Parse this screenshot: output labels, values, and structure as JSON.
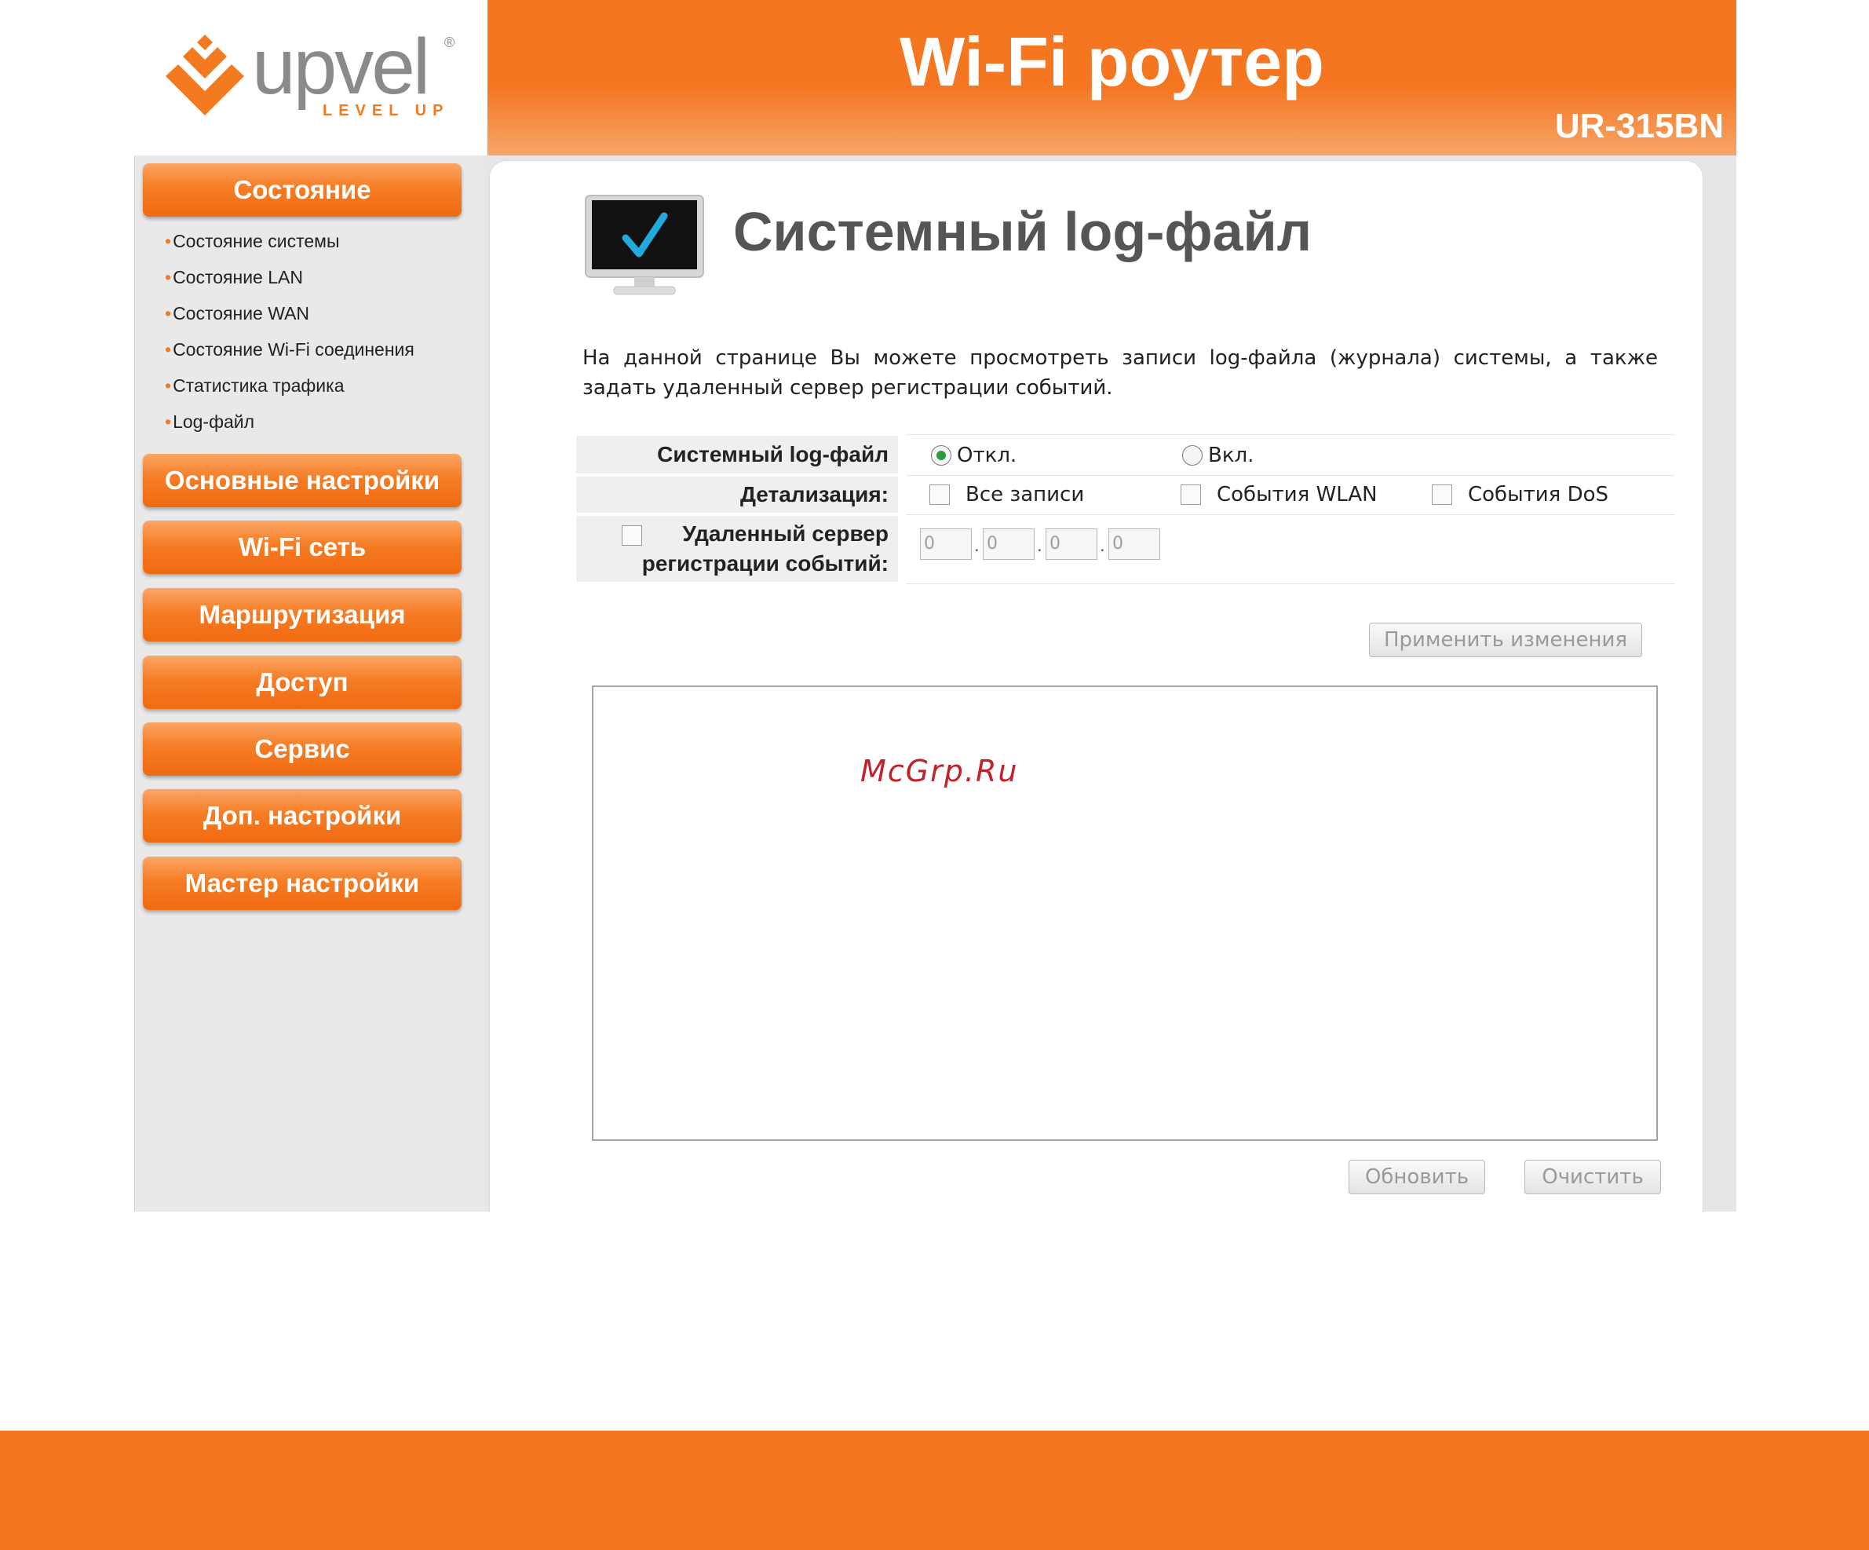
{
  "header": {
    "logo_text": "upvel",
    "logo_tagline": "LEVEL UP",
    "logo_registered": "®",
    "title": "Wi-Fi роутер",
    "model": "UR-315BN"
  },
  "colors": {
    "brand_orange": "#f47621",
    "sidebar_bg": "#e9e9e9",
    "title_gray": "#555555",
    "radio_checked": "#2b9b3c"
  },
  "sidebar": {
    "menus": [
      {
        "label": "Состояние"
      },
      {
        "label": "Основные настройки"
      },
      {
        "label": "Wi-Fi сеть"
      },
      {
        "label": "Маршрутизация"
      },
      {
        "label": "Доступ"
      },
      {
        "label": "Сервис"
      },
      {
        "label": "Доп. настройки"
      },
      {
        "label": "Мастер настройки"
      }
    ],
    "status_subitems": [
      {
        "label": "Состояние системы"
      },
      {
        "label": "Состояние LAN"
      },
      {
        "label": "Состояние WAN"
      },
      {
        "label": "Состояние Wi-Fi соединения"
      },
      {
        "label": "Статистика трафика"
      },
      {
        "label": "Log-файл"
      }
    ]
  },
  "main": {
    "icon": "monitor-check-icon",
    "title": "Системный log-файл",
    "description": "На данной странице Вы можете просмотреть записи log-файла (журнала) системы, а также задать удаленный сервер регистрации событий.",
    "form": {
      "syslog_label": "Системный log-файл",
      "syslog_off": "Откл.",
      "syslog_on": "Вкл.",
      "syslog_value": "off",
      "detail_label": "Детализация:",
      "detail_all": "Все записи",
      "detail_wlan": "События WLAN",
      "detail_dos": "События DoS",
      "remote_label_line1": "Удаленный сервер",
      "remote_label_line2": "регистрации событий:",
      "ip_octets": [
        "0",
        "0",
        "0",
        "0"
      ]
    },
    "apply_button": "Применить изменения",
    "log_text": "",
    "refresh_button": "Обновить",
    "clear_button": "Очистить"
  },
  "watermark": "McGrp.Ru"
}
